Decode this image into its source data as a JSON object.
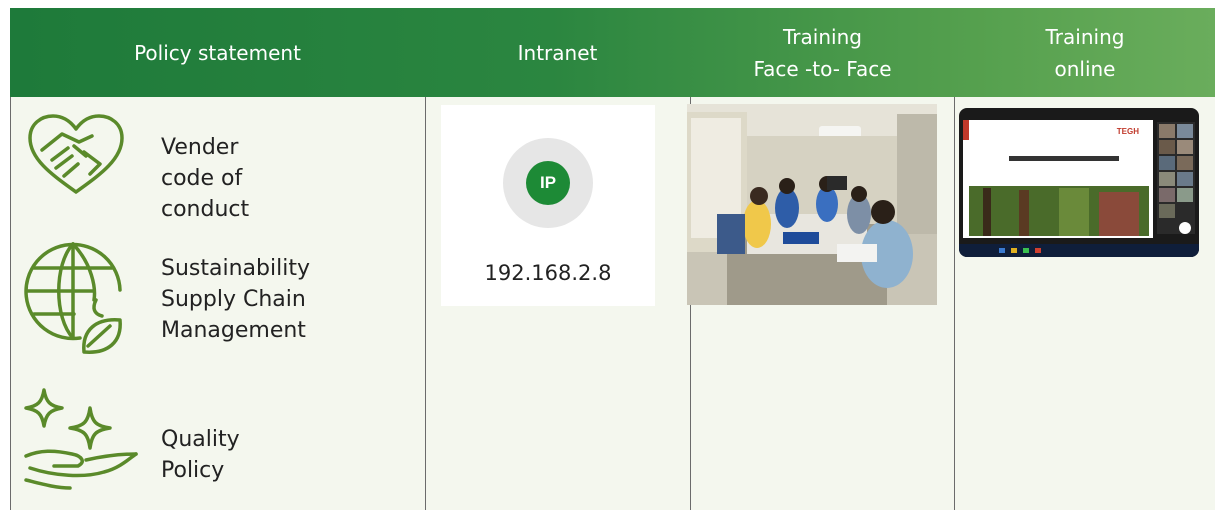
{
  "header": {
    "col1": "Policy statement",
    "col2": "Intranet",
    "col3_line1": "Training",
    "col3_line2": "Face -to- Face",
    "col4_line1": "Training",
    "col4_line2": "online"
  },
  "policies": [
    {
      "label": "Vender code of\nconduct",
      "icon": "handshake-heart-icon"
    },
    {
      "label": "Sustainability\nSupply Chain\nManagement",
      "icon": "globe-leaf-icon"
    },
    {
      "label": "Quality Policy",
      "icon": "sparkle-hand-icon"
    }
  ],
  "intranet": {
    "badge": "IP",
    "address": "192.168.2.8"
  },
  "online_screen": {
    "brand": "TEGH"
  },
  "colors": {
    "header_start": "#1e7a3a",
    "header_end": "#6aad5c",
    "icon_green": "#5a8a2a",
    "body_bg": "#f4f7ee"
  }
}
